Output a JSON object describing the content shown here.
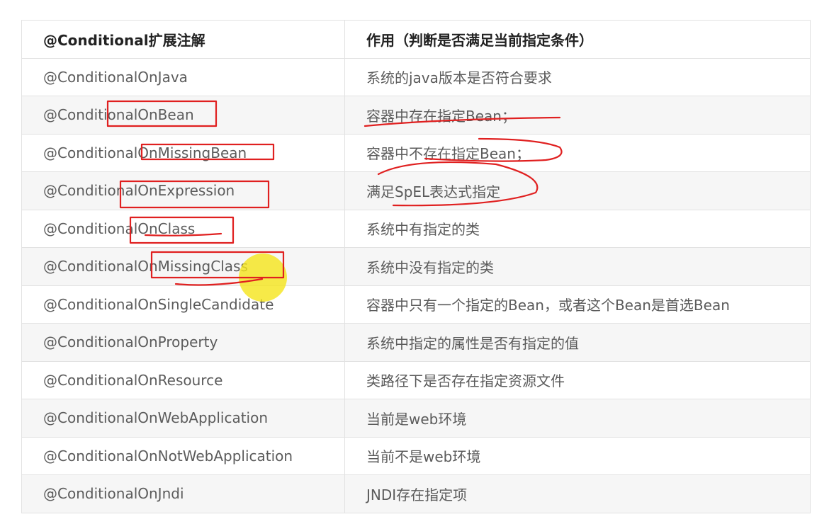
{
  "table": {
    "headers": [
      "@Conditional扩展注解",
      "作用（判断是否满足当前指定条件）"
    ],
    "rows": [
      [
        "@ConditionalOnJava",
        "系统的java版本是否符合要求"
      ],
      [
        "@ConditionalOnBean",
        "容器中存在指定Bean；"
      ],
      [
        "@ConditionalOnMissingBean",
        "容器中不存在指定Bean；"
      ],
      [
        "@ConditionalOnExpression",
        "满足SpEL表达式指定"
      ],
      [
        "@ConditionalOnClass",
        "系统中有指定的类"
      ],
      [
        "@ConditionalOnMissingClass",
        "系统中没有指定的类"
      ],
      [
        "@ConditionalOnSingleCandidate",
        "容器中只有一个指定的Bean，或者这个Bean是首选Bean"
      ],
      [
        "@ConditionalOnProperty",
        "系统中指定的属性是否有指定的值"
      ],
      [
        "@ConditionalOnResource",
        "类路径下是否存在指定资源文件"
      ],
      [
        "@ConditionalOnWebApplication",
        "当前是web环境"
      ],
      [
        "@ConditionalOnNotWebApplication",
        "当前不是web环境"
      ],
      [
        "@ConditionalOnJndi",
        "JNDI存在指定项"
      ]
    ]
  },
  "annotations": {
    "ink_color": "#e02020",
    "highlight_color": "#f5e51a"
  }
}
